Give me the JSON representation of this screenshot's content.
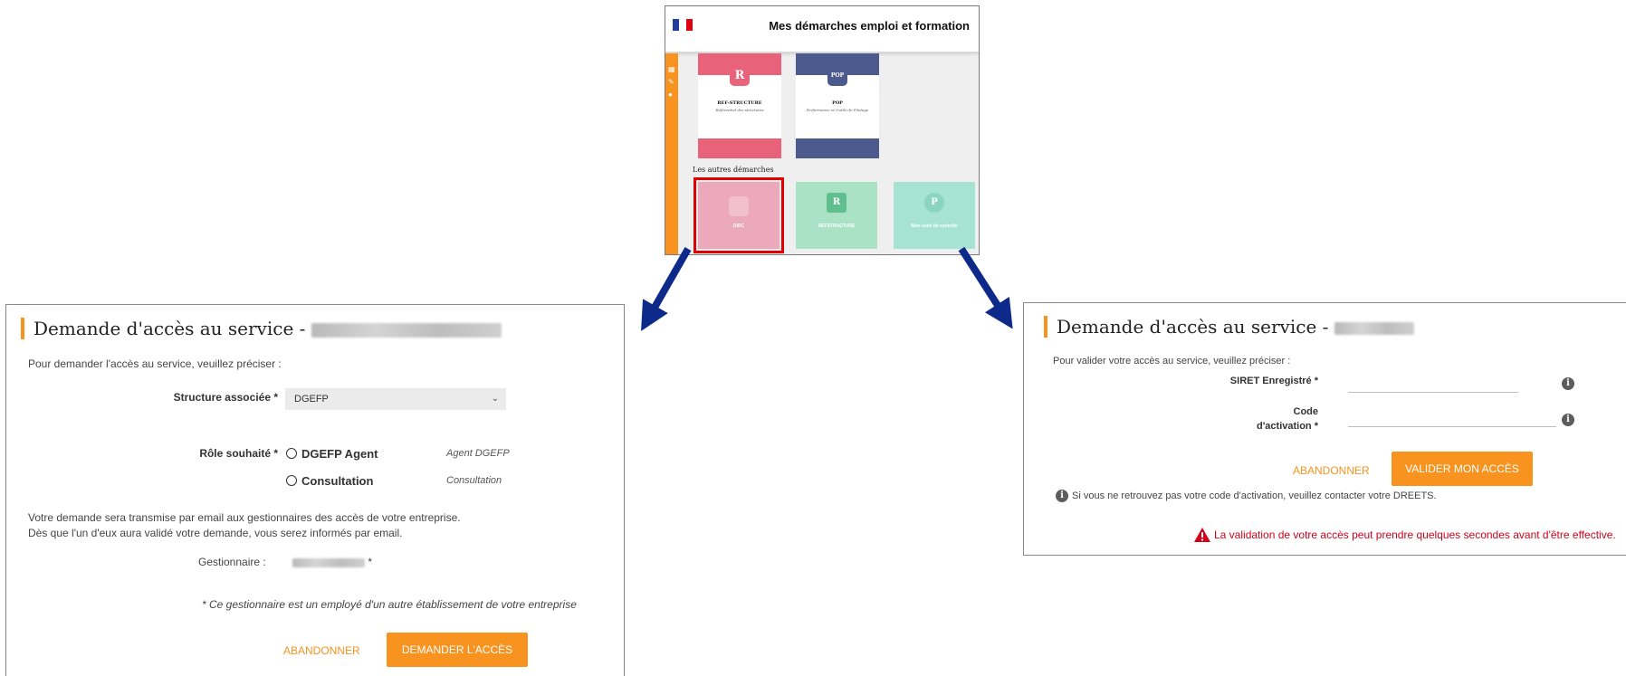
{
  "portal": {
    "title": "Mes démarches emploi et formation",
    "tiles": [
      {
        "name": "REF-STRUCTURE",
        "subtitle": "Référentiel des structures",
        "letter": "R",
        "color": "#e8637a"
      },
      {
        "name": "POP",
        "subtitle": "Performance et Outils de Pilotage",
        "letter": "POP",
        "color": "#4c5a8e"
      }
    ],
    "others_label": "Les autres démarches",
    "other_tiles": [
      {
        "name": "DIRC",
        "color": "#eca9bb"
      },
      {
        "name": "REFSTRUCTURE",
        "color": "#a9e2c4"
      },
      {
        "name": "Mon suivi de contrôle",
        "color": "#a7e3d3"
      }
    ]
  },
  "left_dialog": {
    "title": "Demande d'accès au service - ",
    "intro": "Pour demander l'accès au service, veuillez préciser :",
    "structure_label": "Structure associée *",
    "structure_value": "DGEFP",
    "role_label": "Rôle souhaité *",
    "roles": [
      {
        "label": "DGEFP Agent",
        "hint": "Agent DGEFP"
      },
      {
        "label": "Consultation",
        "hint": "Consultation"
      }
    ],
    "notice_line1": "Votre demande sera transmise par email aux gestionnaires des accès de votre entreprise.",
    "notice_line2": "Dès que l'un d'eux aura validé votre demande, vous serez informés par email.",
    "manager_label": "Gestionnaire :",
    "manager_suffix": "*",
    "footnote": "* Ce gestionnaire est un employé d'un autre établissement de votre entreprise",
    "cancel": "ABANDONNER",
    "submit": "DEMANDER L'ACCÈS"
  },
  "right_dialog": {
    "title": "Demande d'accès au service - ",
    "intro": "Pour valider votre accès au service, veuillez préciser :",
    "siret_label": "SIRET Enregistré *",
    "code_label_1": "Code",
    "code_label_2": "d'activation *",
    "cancel": "ABANDONNER",
    "submit": "VALIDER MON ACCÈS",
    "help": "Si vous ne retrouvez pas votre code d'activation, veuillez contacter votre DREETS.",
    "warning": "La validation de votre accès peut prendre quelques secondes avant d'être effective."
  },
  "colors": {
    "accent": "#f7931e",
    "arrow": "#0d2a8a",
    "warning": "#d0021b"
  }
}
